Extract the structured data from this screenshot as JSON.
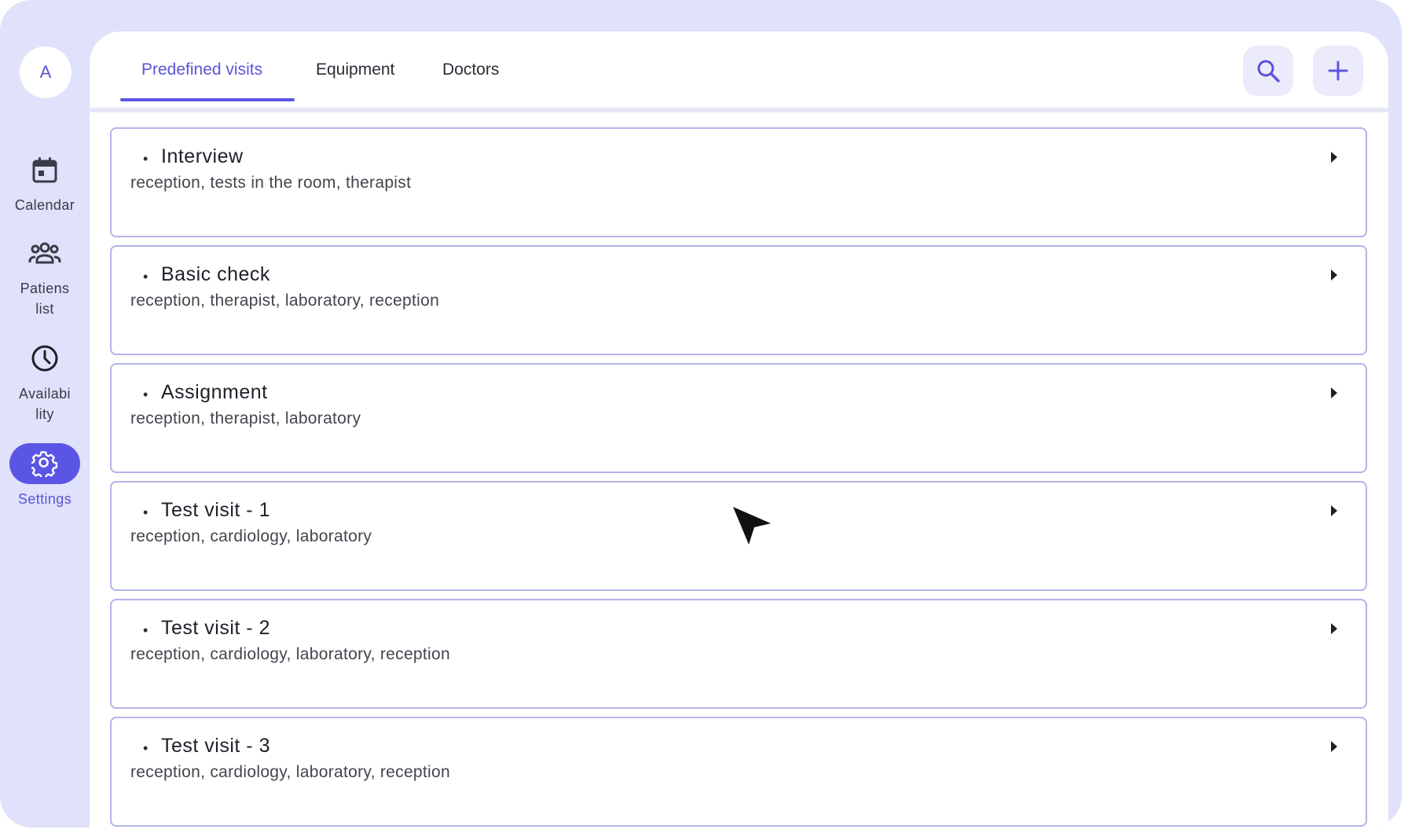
{
  "sidebar": {
    "avatar_letter": "A",
    "items": [
      {
        "label": "Calendar",
        "icon": "calendar-icon"
      },
      {
        "label": "Patiens list",
        "icon": "people-icon"
      },
      {
        "label": "Availabi lity",
        "icon": "clock-icon"
      },
      {
        "label": "Settings",
        "icon": "gear-icon",
        "active": true
      }
    ]
  },
  "tabs": [
    {
      "label": "Predefined visits",
      "active": true
    },
    {
      "label": "Equipment"
    },
    {
      "label": "Doctors"
    }
  ],
  "actions": {
    "search_icon": "search-icon",
    "add_icon": "plus-icon"
  },
  "visits": [
    {
      "title": "Interview",
      "steps": "reception, tests in the room, therapist"
    },
    {
      "title": "Basic check",
      "steps": "reception, therapist, laboratory, reception"
    },
    {
      "title": "Assignment",
      "steps": "reception, therapist, laboratory"
    },
    {
      "title": "Test visit - 1",
      "steps": "reception, cardiology, laboratory"
    },
    {
      "title": "Test visit - 2",
      "steps": "reception, cardiology, laboratory, reception"
    },
    {
      "title": "Test visit - 3",
      "steps": "reception, cardiology, laboratory, reception"
    }
  ],
  "colors": {
    "accent": "#5b55e6",
    "background": "#e0e1fa",
    "card_border": "#b1b4eb"
  }
}
